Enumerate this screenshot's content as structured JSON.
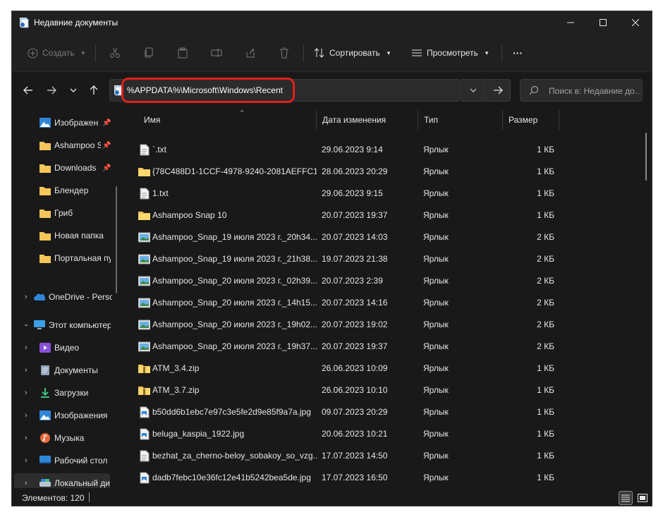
{
  "window": {
    "title": "Недавние документы"
  },
  "toolbar": {
    "create_label": "Создать",
    "sort_label": "Сортировать",
    "view_label": "Просмотреть",
    "more_label": "···"
  },
  "address": {
    "path": "%APPDATA%\\Microsoft\\Windows\\Recent",
    "search_placeholder": "Поиск в: Недавние до..."
  },
  "sidebar": {
    "items": [
      {
        "label": "Изображен",
        "pinned": true,
        "icon": "pictures-icon"
      },
      {
        "label": "Ashampoo S",
        "pinned": true,
        "icon": "folder-icon"
      },
      {
        "label": "Downloads",
        "pinned": true,
        "icon": "folder-icon"
      },
      {
        "label": "Блендер",
        "icon": "folder-icon"
      },
      {
        "label": "Гриб",
        "icon": "folder-icon"
      },
      {
        "label": "Новая папка",
        "icon": "folder-icon"
      },
      {
        "label": "Портальная пу",
        "icon": "folder-icon"
      },
      {
        "label": "OneDrive - Perso",
        "icon": "onedrive-icon"
      },
      {
        "label": "Этот компьютер",
        "icon": "computer-icon"
      },
      {
        "label": "Видео",
        "icon": "videos-icon"
      },
      {
        "label": "Документы",
        "icon": "documents-icon"
      },
      {
        "label": "Загрузки",
        "icon": "downloads-icon"
      },
      {
        "label": "Изображения",
        "icon": "pictures-icon"
      },
      {
        "label": "Музыка",
        "icon": "music-icon"
      },
      {
        "label": "Рабочий стол",
        "icon": "desktop-icon"
      },
      {
        "label": "Локальный ди",
        "icon": "drive-icon"
      }
    ]
  },
  "columns": {
    "name": "Имя",
    "date": "Дата изменения",
    "type": "Тип",
    "size": "Размер"
  },
  "files": [
    {
      "name": "`.txt",
      "date": "29.06.2023 9:14",
      "type": "Ярлык",
      "size": "1 КБ",
      "icon": "text-file-icon"
    },
    {
      "name": "{78C488D1-1CCF-4978-9240-2081AEFFC1...",
      "date": "28.06.2023 20:29",
      "type": "Ярлык",
      "size": "1 КБ",
      "icon": "folder-icon"
    },
    {
      "name": "1.txt",
      "date": "29.06.2023 9:15",
      "type": "Ярлык",
      "size": "1 КБ",
      "icon": "text-file-icon"
    },
    {
      "name": "Ashampoo Snap 10",
      "date": "20.07.2023 19:37",
      "type": "Ярлык",
      "size": "1 КБ",
      "icon": "folder-icon"
    },
    {
      "name": "Ashampoo_Snap_19 июля 2023 г._20h34...",
      "date": "20.07.2023 14:03",
      "type": "Ярлык",
      "size": "2 КБ",
      "icon": "image-file-icon"
    },
    {
      "name": "Ashampoo_Snap_19 июля 2023 г._21h38...",
      "date": "19.07.2023 21:38",
      "type": "Ярлык",
      "size": "2 КБ",
      "icon": "image-file-icon"
    },
    {
      "name": "Ashampoo_Snap_20 июля 2023 г._02h39...",
      "date": "20.07.2023 2:39",
      "type": "Ярлык",
      "size": "2 КБ",
      "icon": "image-file-icon"
    },
    {
      "name": "Ashampoo_Snap_20 июля 2023 г._14h15...",
      "date": "20.07.2023 14:16",
      "type": "Ярлык",
      "size": "2 КБ",
      "icon": "image-file-icon"
    },
    {
      "name": "Ashampoo_Snap_20 июля 2023 г._19h02...",
      "date": "20.07.2023 19:02",
      "type": "Ярлык",
      "size": "2 КБ",
      "icon": "image-file-icon"
    },
    {
      "name": "Ashampoo_Snap_20 июля 2023 г._19h37...",
      "date": "20.07.2023 19:37",
      "type": "Ярлык",
      "size": "2 КБ",
      "icon": "image-file-icon"
    },
    {
      "name": "ATM_3.4.zip",
      "date": "26.06.2023 10:09",
      "type": "Ярлык",
      "size": "1 КБ",
      "icon": "zip-folder-icon"
    },
    {
      "name": "ATM_3.7.zip",
      "date": "26.06.2023 10:10",
      "type": "Ярлык",
      "size": "1 КБ",
      "icon": "zip-folder-icon"
    },
    {
      "name": "b50dd6b1ebc7e97c3e5fe2d9e85f9a7a.jpg",
      "date": "09.07.2023 20:29",
      "type": "Ярлык",
      "size": "1 КБ",
      "icon": "jpg-file-icon"
    },
    {
      "name": "beluga_kaspia_1922.jpg",
      "date": "20.06.2023 10:21",
      "type": "Ярлык",
      "size": "1 КБ",
      "icon": "jpg-file-icon"
    },
    {
      "name": "bezhat_za_cherno-beloy_sobakoy_so_vzg...",
      "date": "17.07.2023 14:50",
      "type": "Ярлык",
      "size": "1 КБ",
      "icon": "text-file-icon"
    },
    {
      "name": "dadb7febc10e36fc12e41b5242bea5de.jpg",
      "date": "17.07.2023 16:50",
      "type": "Ярлык",
      "size": "1 КБ",
      "icon": "jpg-file-icon"
    }
  ],
  "status": {
    "count_text": "Элементов: 120"
  },
  "colors": {
    "highlight": "#e0201b",
    "background": "#191919",
    "folder": "#f6c65a"
  }
}
